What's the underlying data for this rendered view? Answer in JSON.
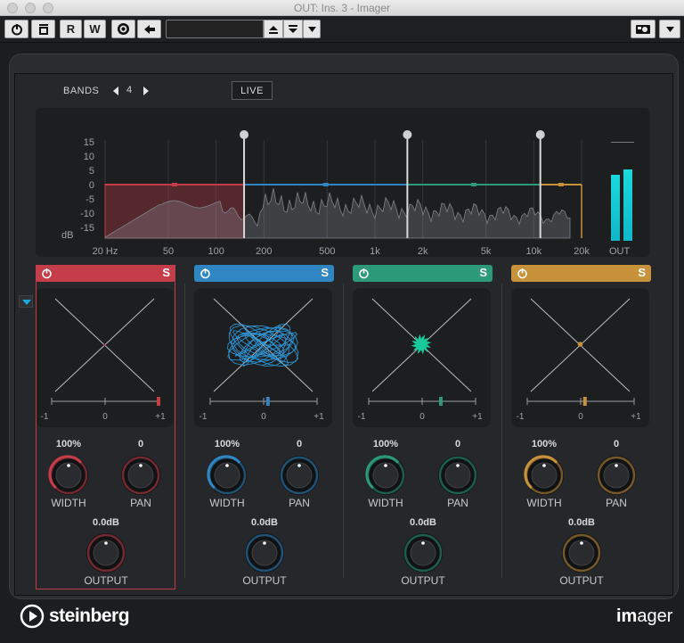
{
  "window": {
    "title": "OUT: Ins. 3 - Imager"
  },
  "toolbar": {
    "read_label": "R",
    "write_label": "W",
    "preset_name": ""
  },
  "header": {
    "bands_label": "BANDS",
    "bands_count": "4",
    "live_label": "LIVE"
  },
  "spectrum": {
    "db_ticks": [
      "15",
      "10",
      "5",
      "0",
      "-5",
      "-10",
      "-15"
    ],
    "db_unit": "dB",
    "freq_ticks": [
      "20 Hz",
      "50",
      "100",
      "200",
      "500",
      "1k",
      "2k",
      "5k",
      "10k",
      "20k"
    ],
    "crossovers_hz": [
      150,
      1600,
      11000
    ],
    "out_label": "OUT",
    "meter_levels": [
      0.6,
      0.65
    ]
  },
  "bands": [
    {
      "color": "#c43d49",
      "width_value": "100%",
      "width_label": "WIDTH",
      "pan_value": "0",
      "pan_label": "PAN",
      "output_value": "0.0dB",
      "output_label": "OUTPUT",
      "solo_label": "S",
      "pos_marker": 1.0,
      "scale": [
        "-1",
        "0",
        "+1"
      ]
    },
    {
      "color": "#2f86c3",
      "width_value": "100%",
      "width_label": "WIDTH",
      "pan_value": "0",
      "pan_label": "PAN",
      "output_value": "0.0dB",
      "output_label": "OUTPUT",
      "solo_label": "S",
      "pos_marker": 0.08,
      "scale": [
        "-1",
        "0",
        "+1"
      ]
    },
    {
      "color": "#2c9a78",
      "width_value": "100%",
      "width_label": "WIDTH",
      "pan_value": "0",
      "pan_label": "PAN",
      "output_value": "0.0dB",
      "output_label": "OUTPUT",
      "solo_label": "S",
      "pos_marker": 0.35,
      "scale": [
        "-1",
        "0",
        "+1"
      ]
    },
    {
      "color": "#c8923a",
      "width_value": "100%",
      "width_label": "WIDTH",
      "pan_value": "0",
      "pan_label": "PAN",
      "output_value": "0.0dB",
      "output_label": "OUTPUT",
      "solo_label": "S",
      "pos_marker": 0.08,
      "scale": [
        "-1",
        "0",
        "+1"
      ]
    }
  ],
  "footer": {
    "brand": "steinberg",
    "product_bold": "im",
    "product_rest": "ager"
  }
}
